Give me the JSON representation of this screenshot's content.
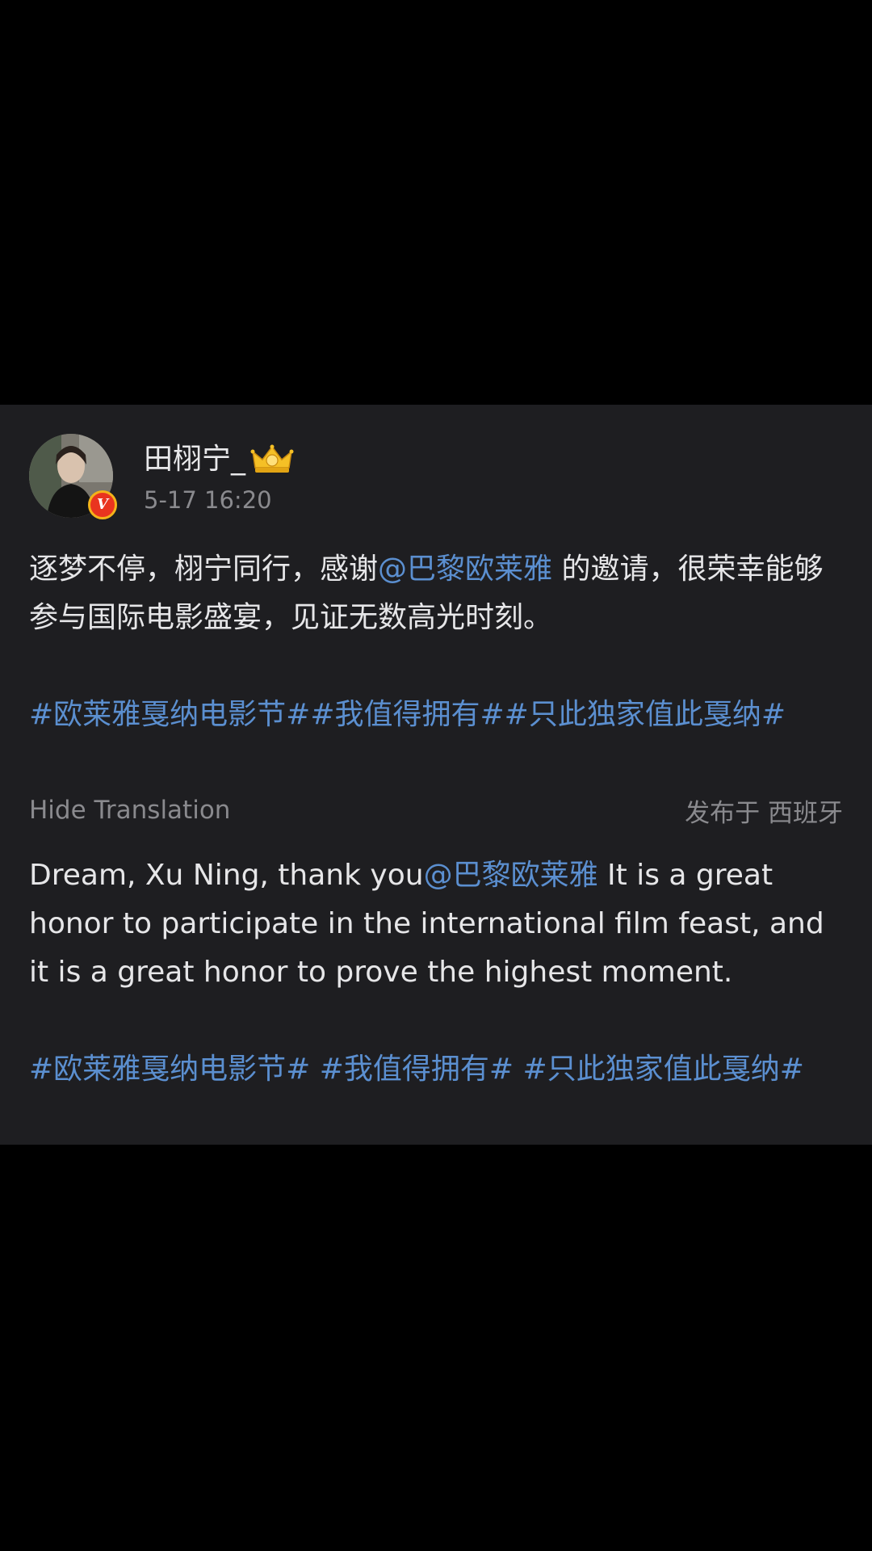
{
  "post": {
    "username": "田栩宁_",
    "timestamp": "5-17 16:20",
    "verified_label": "V",
    "original": {
      "text_before": "逐梦不停，栩宁同行，感谢",
      "mention": "@巴黎欧莱雅",
      "text_after": " 的邀请，很荣幸能够参与国际电影盛宴，见证无数高光时刻。",
      "hashtags": "#欧莱雅戛纳电影节##我值得拥有##只此独家值此戛纳#"
    },
    "hide_translation_label": "Hide Translation",
    "translated_from": "发布于 西班牙",
    "translation": {
      "text_before": "Dream, Xu Ning, thank you",
      "mention": "@巴黎欧莱雅",
      "text_after": " It is a great honor to participate in the international film feast, and it is a great honor to prove the highest moment.",
      "hashtags": "#欧莱雅戛纳电影节# #我值得拥有# #只此独家值此戛纳#"
    }
  },
  "colors": {
    "background": "#000000",
    "card": "#1e1e21",
    "link": "#5b8fd0",
    "text": "#e6e6e8",
    "muted": "#8a8a8e",
    "badge": "#e9341f"
  },
  "icons": {
    "verified": "verified-v-badge-icon",
    "crown": "crown-level-icon"
  }
}
